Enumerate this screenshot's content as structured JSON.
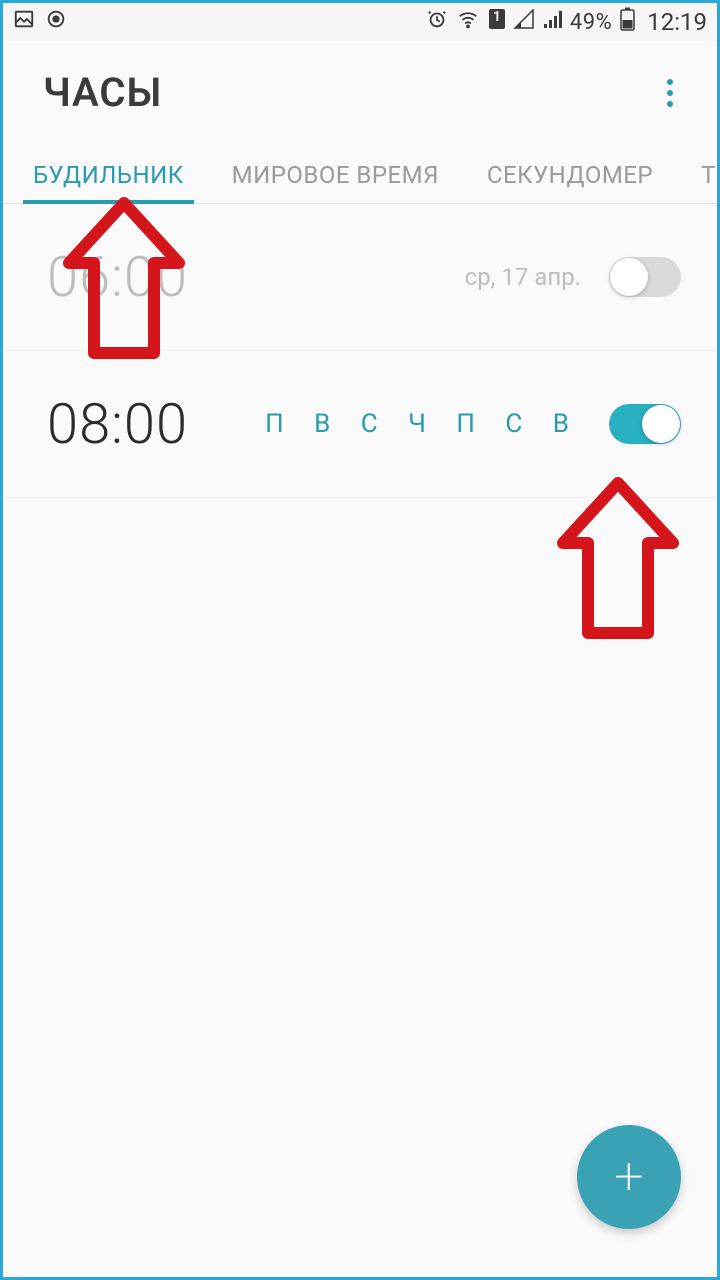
{
  "status": {
    "battery_pct": "49%",
    "time": "12:19",
    "sim_label": "1"
  },
  "header": {
    "title": "ЧАСЫ"
  },
  "tabs": {
    "items": [
      {
        "label": "БУДИЛЬНИК",
        "active": true
      },
      {
        "label": "МИРОВОЕ ВРЕМЯ",
        "active": false
      },
      {
        "label": "СЕКУНДОМЕР",
        "active": false
      },
      {
        "label": "Т",
        "active": false
      }
    ]
  },
  "alarms": [
    {
      "time": "06:00",
      "detail": "ср, 17 апр.",
      "detail_type": "date",
      "enabled": false
    },
    {
      "time": "08:00",
      "detail": "П В С Ч П С В",
      "detail_type": "days",
      "enabled": true
    }
  ],
  "fab": {
    "label": "+"
  }
}
